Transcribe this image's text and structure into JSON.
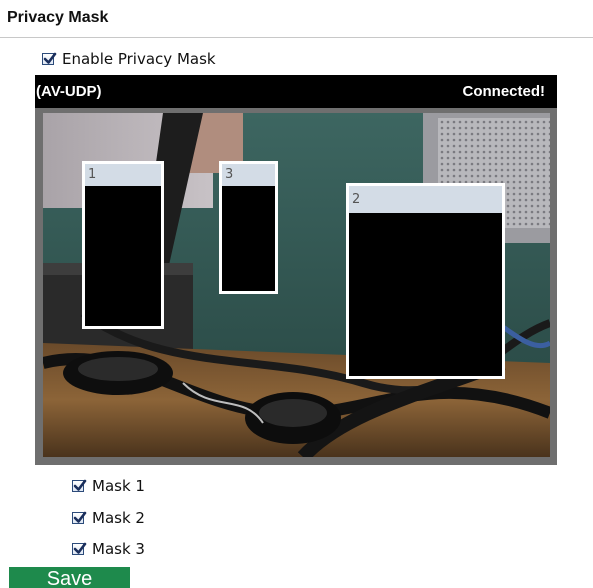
{
  "section": {
    "title": "Privacy Mask"
  },
  "enable_privacy_mask": {
    "label": "Enable Privacy Mask",
    "checked": true
  },
  "video": {
    "source_label": "(AV-UDP)",
    "status_label": "Connected!"
  },
  "masks": [
    {
      "id": "1",
      "label": "Mask 1",
      "checked": true
    },
    {
      "id": "2",
      "label": "Mask 2",
      "checked": true
    },
    {
      "id": "3",
      "label": "Mask 3",
      "checked": true
    }
  ],
  "actions": {
    "save_label": "Save"
  },
  "colors": {
    "save_button": "#1e8a4c",
    "checkbox_border": "#2c4b7a",
    "checkmark": "#1b2f5c",
    "mask_header": "#d3dce6",
    "video_bar": "#000000"
  }
}
